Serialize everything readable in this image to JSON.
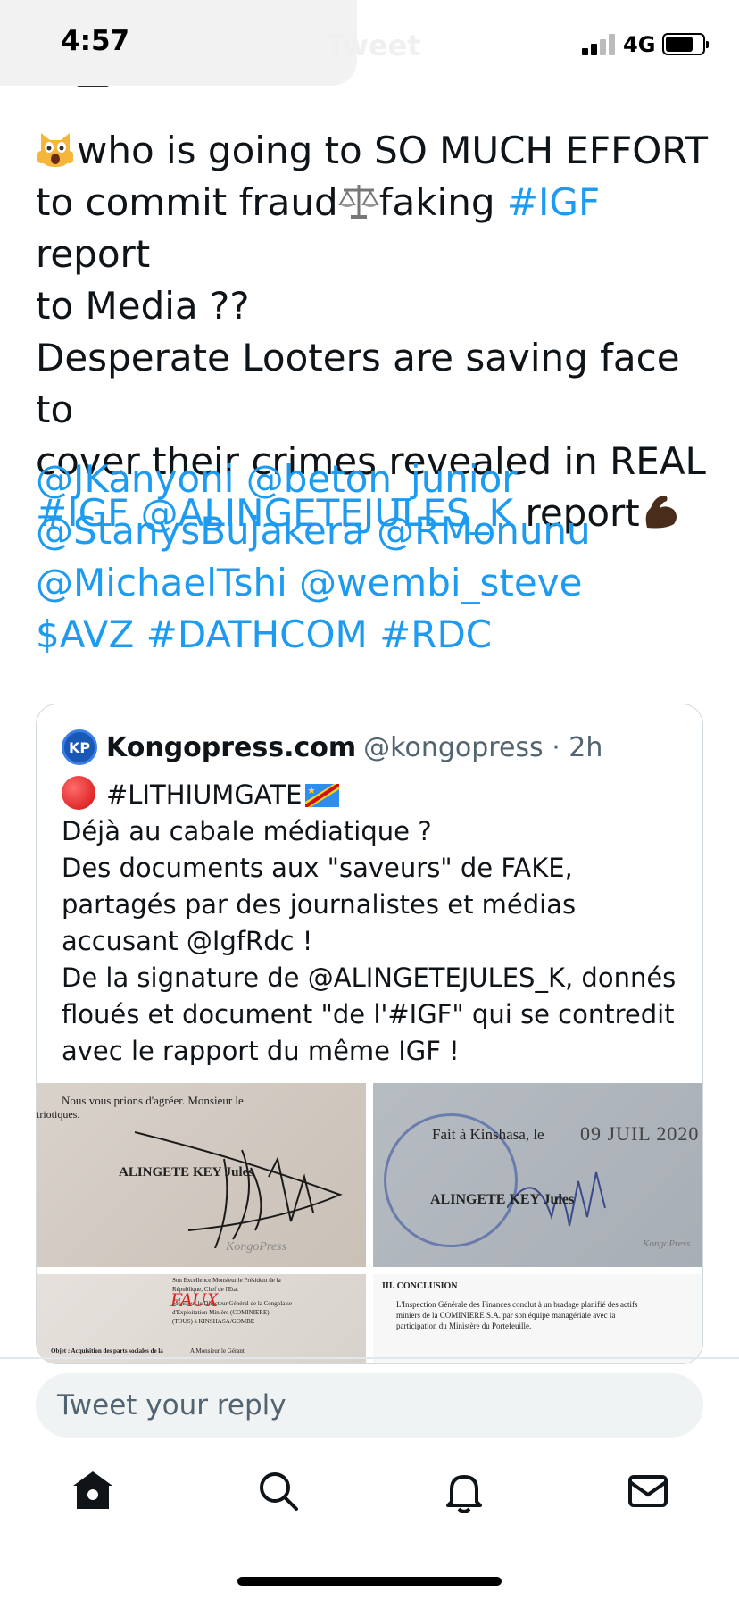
{
  "status_bar": {
    "time": "4:57",
    "network": "4G",
    "title_ghost": "Tweet"
  },
  "tweet": {
    "line1_text": "who is going to SO MUCH EFFORT",
    "line2_a": "to commit fraud",
    "line2_b": "faking ",
    "line2_hashtag": "#IGF",
    "line2_c": " report",
    "line3": "to Media ??",
    "line4": "Desperate Looters are saving face to",
    "line5": "cover their crimes revealed in REAL",
    "line6_hashtag": "#IGF",
    "line6_mention": "@ALINGETEJULES_K",
    "line6_text": " report",
    "mentions": [
      "@JKanyoni @beton_junior",
      "@StanysBujakera @RMonunu",
      "@MichaelTshi @wembi_steve",
      "$AVZ #DATHCOM #RDC"
    ]
  },
  "quote": {
    "avatar_text": "KP",
    "name": "Kongopress.com",
    "handle": "@kongopress · 2h",
    "lines": [
      "#LITHIUMGATE",
      "Déjà au cabale médiatique ?",
      "Des documents aux \"saveurs\" de FAKE,",
      "partagés par des journalistes et médias",
      "accusant @IgfRdc !",
      "De la signature de @ALINGETEJULES_K, donnés",
      "floués et document \"de l'#IGF\" qui se contredit",
      "avec le rapport du même IGF !"
    ],
    "media": {
      "img1_top": "Nous vous prions d'agréer. Monsieur le",
      "img1_top2": "triotiques.",
      "img1_name": "ALINGETE KEY Jules",
      "img1_watermark": "KongoPress",
      "img2_place": "Fait à Kinshasa, le",
      "img2_date": "09 JUIL 2020",
      "img2_name": "ALINGETE KEY Jules",
      "img2_watermark": "KongoPress",
      "img3_faux": "FAUX",
      "img3_lines": [
        "Son Excellence Monsieur le Président de la",
        "République, Chef de l'Etat",
        "Monsieur le Directeur Général de la Congolaise",
        "d'Exploitation Minière (COMINIERE)",
        "(TOUS) à KINSHASA/GOMBE"
      ],
      "img3_object": "Objet : Acquisition des parts sociales de la",
      "img3_gerant": "A Monsieur le Gérant",
      "img4_heading": "III. CONCLUSION",
      "img4_lines": [
        "L'Inspection Générale des Finances conclut à un bradage planifié des actifs",
        "miniers de la COMINIERE S.A. par son équipe managériale avec la",
        "participation du Ministère du Portefeuille."
      ]
    }
  },
  "reply": {
    "placeholder": "Tweet your reply"
  },
  "tabs": [
    "home-icon",
    "search-icon",
    "notifications-icon",
    "messages-icon"
  ],
  "colors": {
    "link": "#1d9bf0",
    "text": "#0f1419",
    "muted": "#536471"
  }
}
